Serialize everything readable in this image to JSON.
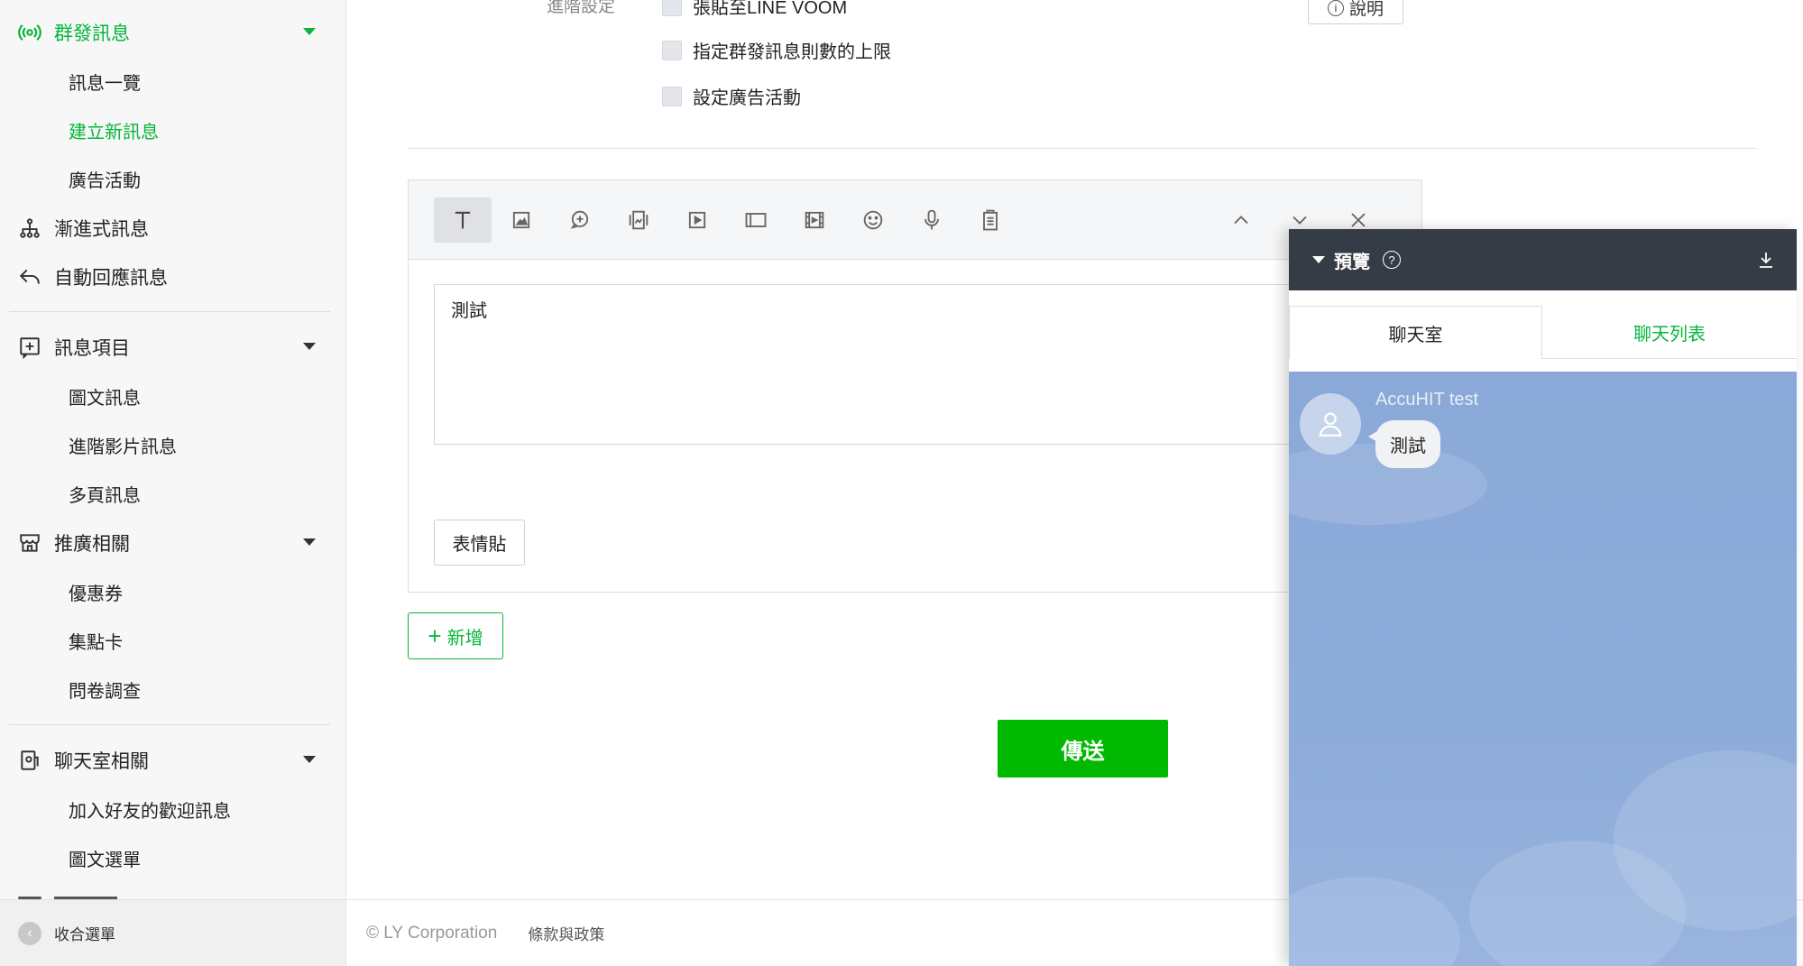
{
  "sidebar": {
    "broadcast": {
      "label": "群發訊息",
      "items": [
        "訊息一覽",
        "建立新訊息",
        "廣告活動"
      ]
    },
    "step_messages": "漸進式訊息",
    "auto_reply": "自動回應訊息",
    "message_items": {
      "label": "訊息項目",
      "items": [
        "圖文訊息",
        "進階影片訊息",
        "多頁訊息"
      ]
    },
    "promotion": {
      "label": "推廣相關",
      "items": [
        "優惠券",
        "集點卡",
        "問卷調查"
      ]
    },
    "chat_related": {
      "label": "聊天室相關",
      "items": [
        "加入好友的歡迎訊息",
        "圖文選單"
      ]
    },
    "collapse": "收合選單"
  },
  "main": {
    "advanced_label": "進階設定",
    "options": [
      "張貼至LINE VOOM",
      "指定群發訊息則數的上限",
      "設定廣告活動"
    ],
    "help_button": "說明",
    "toolbar_icons": [
      "text-icon",
      "image-icon",
      "chat-bubble-icon",
      "card-icon",
      "video-icon",
      "imagemap-icon",
      "film-icon",
      "smiley-icon",
      "microphone-icon",
      "clipboard-icon"
    ],
    "message_text": "測試",
    "emoji_button": "表情貼",
    "add_button": "新增",
    "send_button": "傳送"
  },
  "footer": {
    "copyright": "© LY Corporation",
    "terms": "條款與政策"
  },
  "preview": {
    "title": "預覽",
    "tabs": [
      "聊天室",
      "聊天列表"
    ],
    "sender": "AccuHIT test",
    "bubble_text": "測試"
  },
  "colors": {
    "accent": "#06b63b",
    "send": "#00b900",
    "preview_header": "#363c45",
    "chat_bg": "#8aa9d8"
  }
}
